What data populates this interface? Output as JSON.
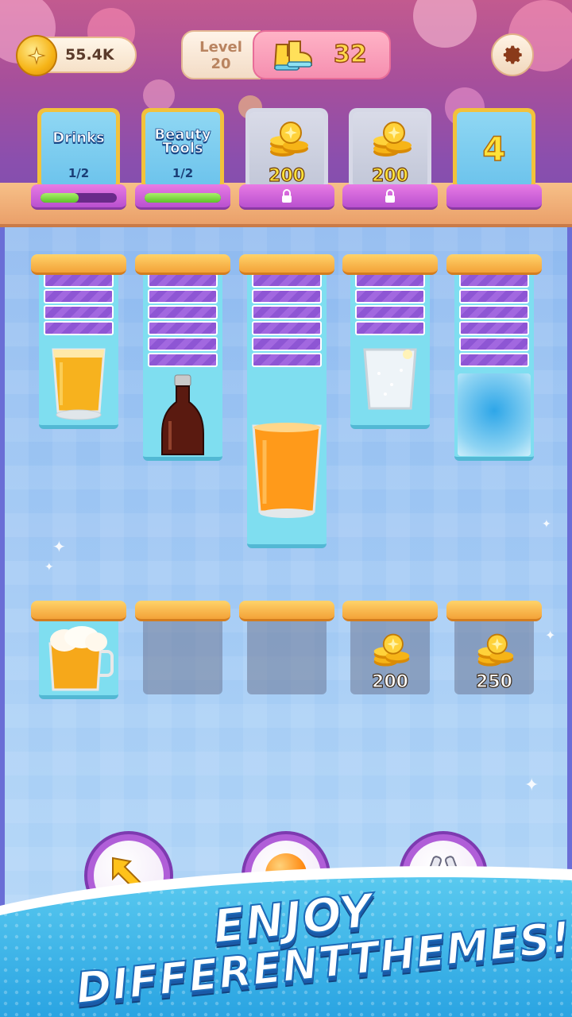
{
  "hud": {
    "coins": "55.4K",
    "level_label": "Level",
    "level_number": "20",
    "moves_count": "32",
    "icons": {
      "coin": "coin-icon",
      "moves": "boots-icon",
      "settings": "gear-icon"
    }
  },
  "orders": [
    {
      "title": "Drinks",
      "progress_text": "1/2",
      "progress": 0.5,
      "state": "active"
    },
    {
      "title": "Beauty\nTools",
      "progress_text": "1/2",
      "progress": 1.0,
      "state": "active"
    },
    {
      "cost": "200",
      "state": "locked"
    },
    {
      "cost": "200",
      "state": "locked"
    },
    {
      "count": "4",
      "state": "remaining"
    }
  ],
  "columns": [
    {
      "hidden_cards": 4,
      "top_item": "beer-glass"
    },
    {
      "hidden_cards": 6,
      "top_item": "cola-bottle"
    },
    {
      "hidden_cards": 6,
      "top_item": "orange-juice-glass"
    },
    {
      "hidden_cards": 4,
      "top_item": "soda-water-glass"
    },
    {
      "hidden_cards": 6,
      "top_item": "frost-card"
    }
  ],
  "holding_slots": [
    {
      "state": "filled",
      "item": "foamy-beer-mug"
    },
    {
      "state": "empty"
    },
    {
      "state": "empty"
    },
    {
      "state": "locked",
      "cost": "200"
    },
    {
      "state": "locked",
      "cost": "250"
    }
  ],
  "boosters": [
    {
      "icon": "undo-arrow-icon"
    },
    {
      "icon": "orange-ball-icon"
    },
    {
      "icon": "magnet-icon"
    }
  ],
  "banner": {
    "line1": "ENJOY",
    "line2": "DIFFERENTTHEMES!"
  },
  "colors": {
    "accent_gold": "#f2c23b",
    "card_blue": "#7fdef0",
    "hidden_purple": "#a268e0",
    "pink_pill": "#f58fb0"
  }
}
